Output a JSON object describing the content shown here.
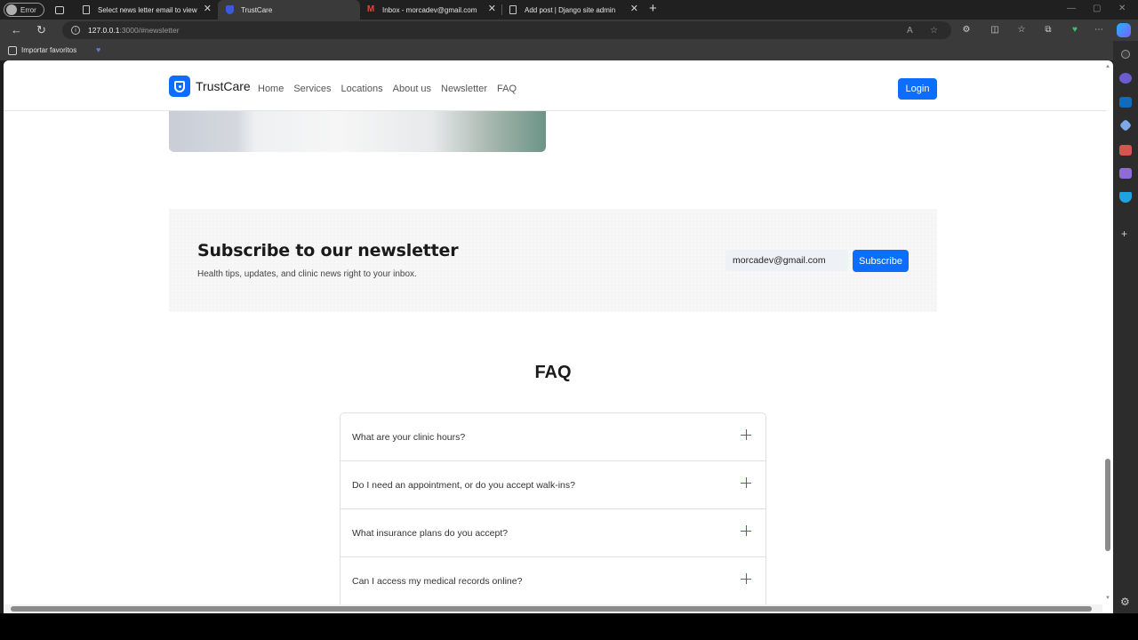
{
  "browser": {
    "profile_label": "Error",
    "tabs": [
      {
        "title": "Select news letter email to view",
        "favicon": "doc-icon"
      },
      {
        "title": "TrustCare",
        "favicon": "shield-icon"
      },
      {
        "title": "Inbox - morcadev@gmail.com",
        "favicon": "gmail-icon"
      },
      {
        "title": "Add post | Django site admin",
        "favicon": "doc-icon"
      }
    ],
    "url_host": "127.0.0.1",
    "url_rest": ":3000/#newsletter",
    "favorites": {
      "import_label": "Importar favoritos"
    }
  },
  "site": {
    "brand": "TrustCare",
    "nav": [
      "Home",
      "Services",
      "Locations",
      "About us",
      "Newsletter",
      "FAQ"
    ],
    "login_label": "Login",
    "accent_color": "#0d6efd"
  },
  "newsletter": {
    "title": "Subscribe to our newsletter",
    "subtitle": "Health tips, updates, and clinic news right to your inbox.",
    "email_value": "morcadev@gmail.com",
    "subscribe_label": "Subscribe"
  },
  "faq": {
    "title": "FAQ",
    "questions": [
      "What are your clinic hours?",
      "Do I need an appointment, or do you accept walk-ins?",
      "What insurance plans do you accept?",
      "Can I access my medical records online?"
    ]
  }
}
